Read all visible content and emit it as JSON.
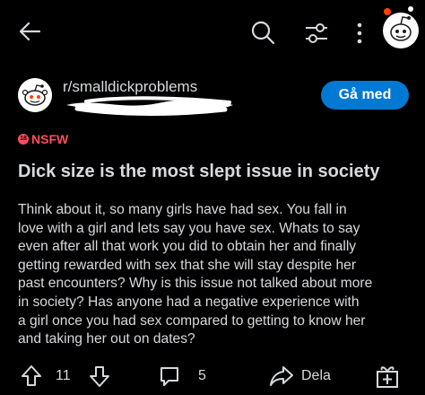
{
  "colors": {
    "background": "#000000",
    "text": "#d7dadc",
    "accent": "#0079d3",
    "nsfw": "#ff4f5e"
  },
  "topbar": {
    "icons": [
      "back-arrow-icon",
      "search-icon",
      "filter-icon",
      "more-vertical-icon",
      "user-avatar-icon"
    ]
  },
  "post": {
    "subreddit": "r/smalldickproblems",
    "join_label": "Gå med",
    "nsfw_label": "NSFW",
    "nsfw_badge": "18",
    "title": "Dick size is the most slept issue in society",
    "body_lines": [
      "Think about it, so many girls have had sex. You fall in",
      "love with a girl and lets say you have sex. Whats to say",
      "even after all that work you did to obtain her and finally",
      "getting rewarded with sex that she will stay despite her",
      "past encounters? Why is this issue not talked about more",
      "in society? Has anyone had a negative experience with",
      "a girl once you had sex compared to getting to know her",
      "and taking her out on dates?"
    ]
  },
  "actions": {
    "votes": "11",
    "comments": "5",
    "share_label": "Dela",
    "icons": [
      "upvote-icon",
      "downvote-icon",
      "comment-icon",
      "share-icon",
      "award-icon"
    ]
  }
}
